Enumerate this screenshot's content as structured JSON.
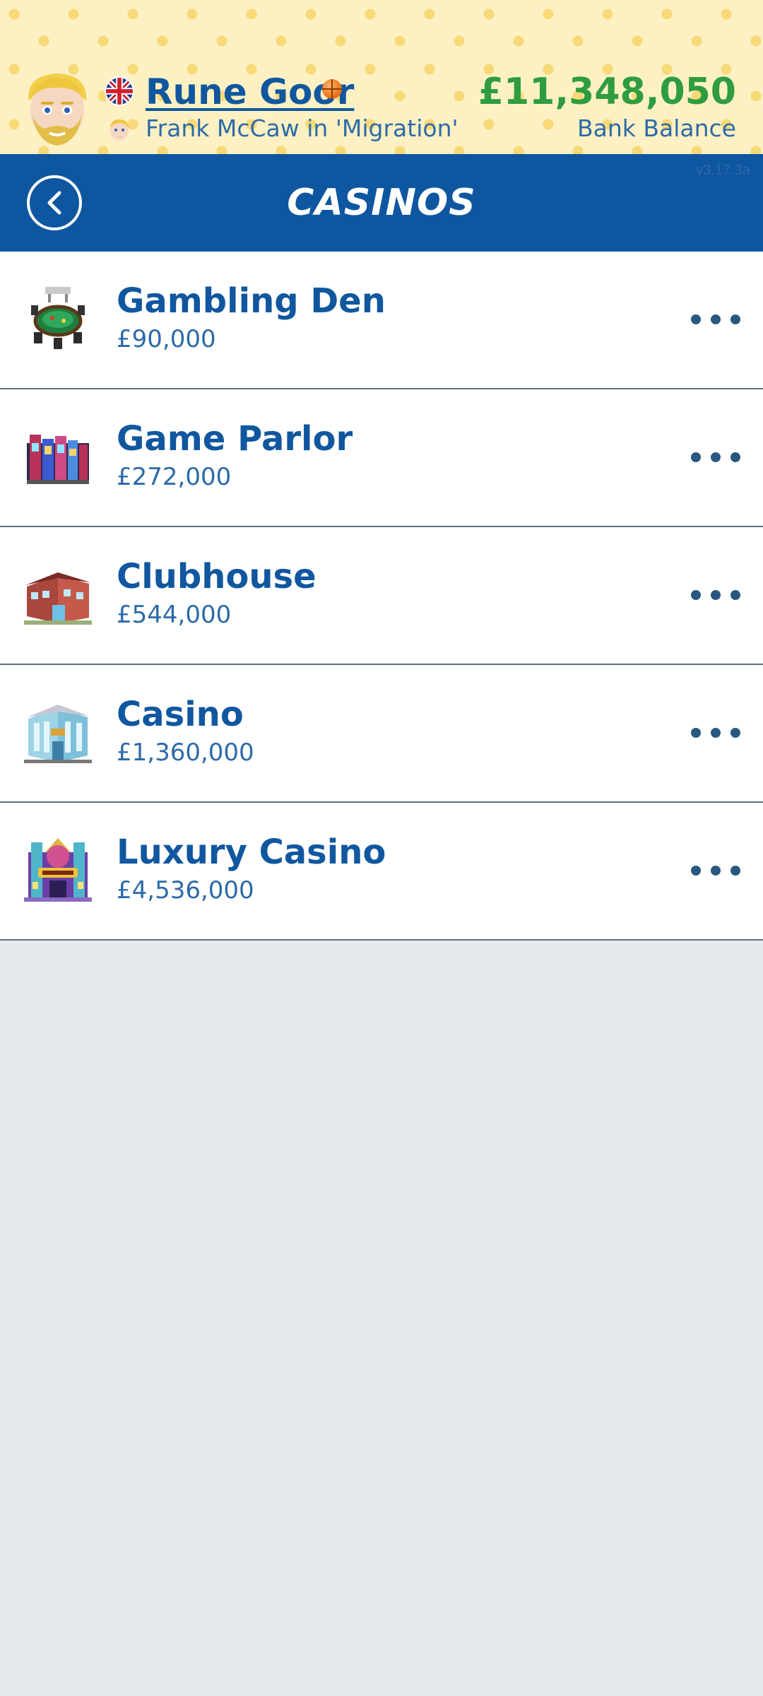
{
  "header": {
    "player_name": "Rune Goor",
    "subtitle": "Frank McCaw in 'Migration'",
    "balance": "£11,348,050",
    "balance_label": "Bank Balance",
    "icons": [
      "avatar",
      "uk-flag-icon",
      "basketball-icon",
      "mini-avatar"
    ]
  },
  "title_bar": {
    "title": "CASINOS",
    "version": "v3.17.3a",
    "back_icon": "chevron-left-icon"
  },
  "casinos": [
    {
      "name": "Gambling Den",
      "price": "£90,000",
      "icon": "gambling-den-icon"
    },
    {
      "name": "Game Parlor",
      "price": "£272,000",
      "icon": "game-parlor-icon"
    },
    {
      "name": "Clubhouse",
      "price": "£544,000",
      "icon": "clubhouse-icon"
    },
    {
      "name": "Casino",
      "price": "£1,360,000",
      "icon": "casino-icon"
    },
    {
      "name": "Luxury Casino",
      "price": "£4,536,000",
      "icon": "luxury-casino-icon"
    }
  ],
  "colors": {
    "header_bg": "#fdf1c3",
    "title_bar_bg": "#0e57a0",
    "primary_text": "#10579f",
    "balance_green": "#2f9c3f",
    "page_bg": "#e5e9ee"
  }
}
